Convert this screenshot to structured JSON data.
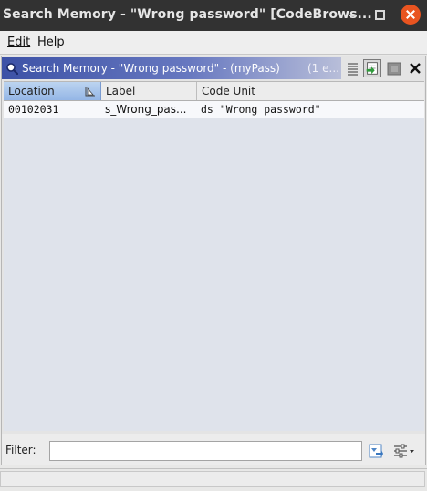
{
  "window": {
    "title": "Search Memory - \"Wrong password\" [CodeBrows..."
  },
  "menubar": {
    "items": [
      {
        "label": "Edit",
        "mnemonic": "E"
      },
      {
        "label": "Help",
        "mnemonic": "H"
      }
    ]
  },
  "panel": {
    "title": "Search Memory - \"Wrong password\" - (myPass)",
    "count": "(1 e...",
    "colors": {
      "header_start": "#3d52a6",
      "header_end": "#b8bed9"
    }
  },
  "table": {
    "columns": [
      "Location",
      "Label",
      "Code Unit"
    ],
    "rows": [
      {
        "location": "00102031",
        "label": "s_Wrong_pas...",
        "code_unit": "ds \"Wrong password\""
      }
    ]
  },
  "filter": {
    "label": "Filter:",
    "value": ""
  },
  "icons": [
    "search-icon",
    "sort-icon",
    "list-view-icon",
    "select-in-listing-icon",
    "memory-icon",
    "close-icon",
    "filter-options-icon",
    "filter-settings-icon"
  ]
}
